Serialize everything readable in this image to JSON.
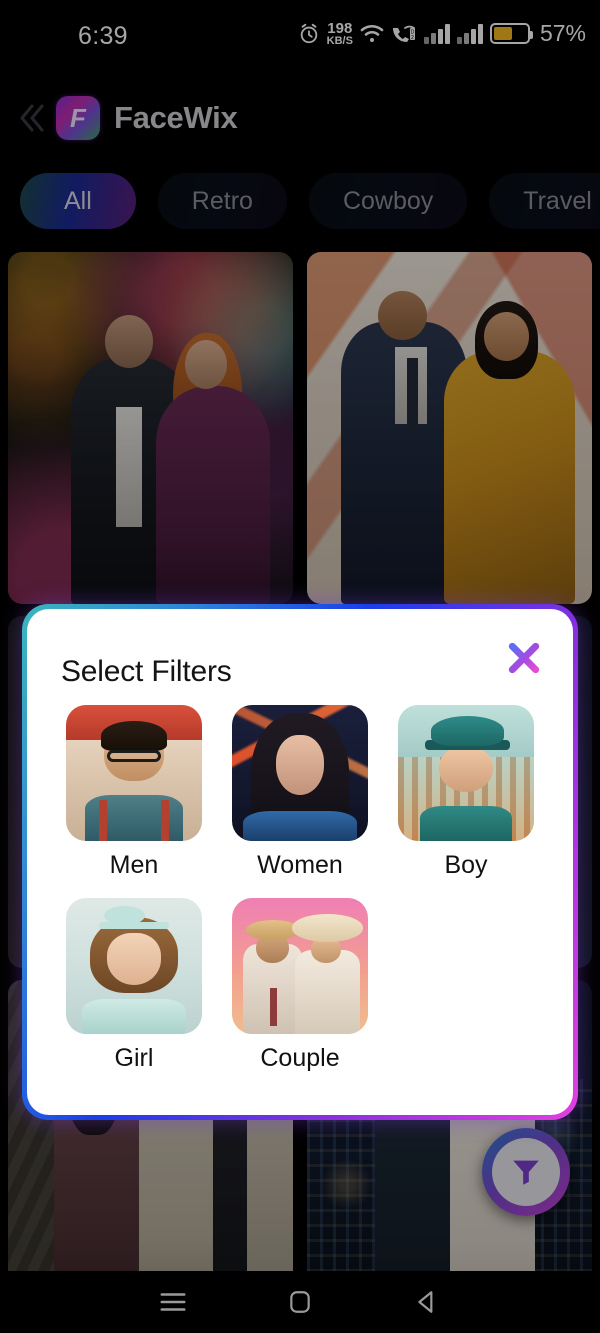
{
  "status_bar": {
    "time": "6:39",
    "alarm_icon": "alarm-clock-icon",
    "net_speed_value": "198",
    "net_speed_unit": "KB/S",
    "wifi_icon": "wifi-icon",
    "call_icon": "call-data-icon",
    "signal_1_icon": "signal-bars-icon",
    "signal_2_icon": "signal-bars-icon",
    "battery_icon": "battery-icon",
    "battery_percent": "57%",
    "battery_level": 57
  },
  "app_bar": {
    "back_icon": "double-chevron-left-icon",
    "logo_icon": "facewix-logo-icon",
    "logo_glyph": "F",
    "title": "FaceWix"
  },
  "categories": {
    "selected": "All",
    "chips": [
      {
        "label": "All",
        "selected": true
      },
      {
        "label": "Retro",
        "selected": false
      },
      {
        "label": "Cowboy",
        "selected": false
      },
      {
        "label": "Travel",
        "selected": false
      }
    ]
  },
  "gallery": {
    "cards": [
      {
        "name": "butterfly-garden-couple"
      },
      {
        "name": "golden-saree-couple"
      },
      {
        "name": "hidden-card-left"
      },
      {
        "name": "hidden-card-right"
      },
      {
        "name": "travel-backpack-couple"
      },
      {
        "name": "rooftop-night-couple"
      }
    ]
  },
  "fab": {
    "icon": "filter-funnel-icon"
  },
  "dialog": {
    "title": "Select Filters",
    "close_icon": "close-x-icon",
    "filters": [
      {
        "label": "Men",
        "thumb": "men-retro-portrait"
      },
      {
        "label": "Women",
        "thumb": "women-neon-portrait"
      },
      {
        "label": "Boy",
        "thumb": "boy-cap-portrait"
      },
      {
        "label": "Girl",
        "thumb": "girl-bow-portrait"
      },
      {
        "label": "Couple",
        "thumb": "couple-hats-portrait"
      }
    ]
  },
  "nav_bar": {
    "recents_icon": "recents-menu-icon",
    "home_icon": "home-square-icon",
    "back_icon": "back-triangle-icon"
  },
  "colors": {
    "accent_teal": "#3bb6bd",
    "accent_blue": "#1a3ee8",
    "accent_purple": "#8a2fe0",
    "accent_magenta": "#e23fe0",
    "battery_amber": "#f5b921",
    "dialog_bg": "#ffffff",
    "page_bg": "#000000"
  }
}
